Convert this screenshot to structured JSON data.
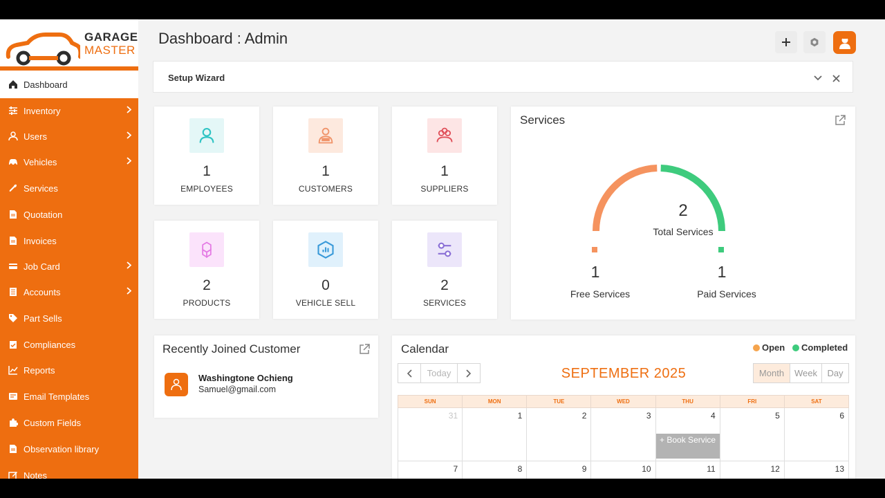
{
  "brand": {
    "line1": "GARAGE",
    "line2": "MASTER",
    "accent": "#ee6e10"
  },
  "header": {
    "title": "Dashboard : Admin"
  },
  "sidebar": {
    "items": [
      {
        "label": "Dashboard",
        "icon": "home-icon",
        "has_children": false
      },
      {
        "label": "Inventory",
        "icon": "sliders-icon",
        "has_children": true
      },
      {
        "label": "Users",
        "icon": "user-icon",
        "has_children": true
      },
      {
        "label": "Vehicles",
        "icon": "car-icon",
        "has_children": true
      },
      {
        "label": "Services",
        "icon": "wrench-icon",
        "has_children": false
      },
      {
        "label": "Quotation",
        "icon": "file-icon",
        "has_children": false
      },
      {
        "label": "Invoices",
        "icon": "file-icon",
        "has_children": false
      },
      {
        "label": "Job Card",
        "icon": "card-icon",
        "has_children": true
      },
      {
        "label": "Accounts",
        "icon": "ledger-icon",
        "has_children": true
      },
      {
        "label": "Part Sells",
        "icon": "tag-icon",
        "has_children": false
      },
      {
        "label": "Compliances",
        "icon": "clipboard-check-icon",
        "has_children": false
      },
      {
        "label": "Reports",
        "icon": "chart-line-icon",
        "has_children": false
      },
      {
        "label": "Email Templates",
        "icon": "envelope-icon",
        "has_children": false
      },
      {
        "label": "Custom Fields",
        "icon": "puzzle-icon",
        "has_children": false
      },
      {
        "label": "Observation library",
        "icon": "file-icon",
        "has_children": false
      },
      {
        "label": "Notes",
        "icon": "edit-icon",
        "has_children": false
      }
    ]
  },
  "wizard": {
    "title": "Setup Wizard"
  },
  "stats": [
    {
      "value": "1",
      "label": "EMPLOYEES",
      "icon": "user-outline-icon",
      "bg": "#e4f7f7",
      "fg": "#2fc4c4"
    },
    {
      "value": "1",
      "label": "CUSTOMERS",
      "icon": "client-icon",
      "bg": "#fde9de",
      "fg": "#f0946a"
    },
    {
      "value": "1",
      "label": "SUPPLIERS",
      "icon": "group-icon",
      "bg": "#fde5e5",
      "fg": "#e0505a"
    },
    {
      "value": "2",
      "label": "PRODUCTS",
      "icon": "cubes-icon",
      "bg": "#fbe3fb",
      "fg": "#e47ae4"
    },
    {
      "value": "0",
      "label": "VEHICLE SELL",
      "icon": "hexagon-chart-icon",
      "bg": "#e0f1fc",
      "fg": "#3a9ad9"
    },
    {
      "value": "2",
      "label": "SERVICES",
      "icon": "toggle-sliders-icon",
      "bg": "#ece6fa",
      "fg": "#8a6fd6"
    }
  ],
  "services": {
    "title": "Services",
    "total": "2",
    "total_label": "Total Services",
    "free_value": "1",
    "free_label": "Free Services",
    "paid_value": "1",
    "paid_label": "Paid Services",
    "free_color": "#f5935f",
    "paid_color": "#3ecb7d"
  },
  "recent": {
    "title": "Recently Joined Customer",
    "name": "Washingtone Ochieng",
    "email": "Samuel@gmail.com"
  },
  "calendar": {
    "title": "Calendar",
    "legend_open": "Open",
    "legend_completed": "Completed",
    "open_color": "#f5a44d",
    "completed_color": "#3ecb7d",
    "today_label": "Today",
    "month_label": "SEPTEMBER 2025",
    "views": [
      "Month",
      "Week",
      "Day"
    ],
    "weekdays": [
      "SUN",
      "MON",
      "TUE",
      "WED",
      "THU",
      "FRI",
      "SAT"
    ],
    "week1": [
      "31",
      "1",
      "2",
      "3",
      "4",
      "5",
      "6"
    ],
    "week2": [
      "7",
      "8",
      "9",
      "10",
      "11",
      "12",
      "13"
    ],
    "book_label": "+ Book Service"
  }
}
